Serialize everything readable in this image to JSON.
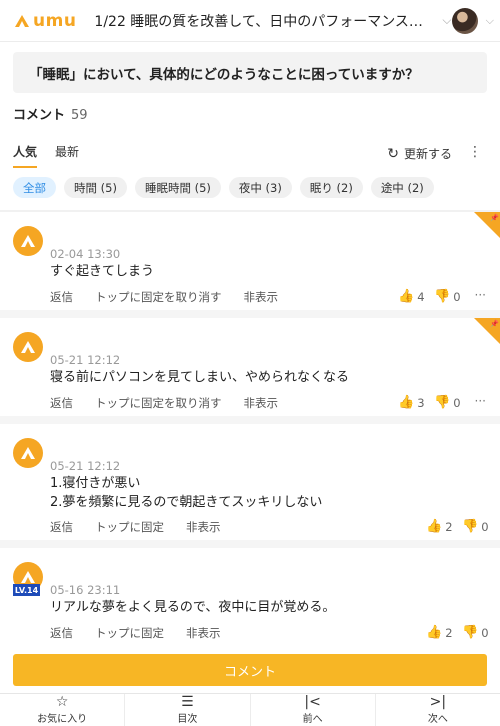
{
  "header": {
    "logo_text": "umu",
    "title": "1/22 睡眠の質を改善して、日中のパフォーマンスをあげよ…",
    "chevron_icon": "chevron-down-icon"
  },
  "question": "「睡眠」において、具体的にどのようなことに困っていますか？",
  "comments_header": {
    "label": "コメント",
    "count": "59"
  },
  "tabs": [
    {
      "label": "人気",
      "active": true
    },
    {
      "label": "最新",
      "active": false
    }
  ],
  "refresh_label": "更新する",
  "filters": [
    {
      "label": "全部",
      "active": true
    },
    {
      "label": "時間 (5)"
    },
    {
      "label": "睡眠時間 (5)"
    },
    {
      "label": "夜中 (3)"
    },
    {
      "label": "眠り (2)"
    },
    {
      "label": "途中 (2)"
    }
  ],
  "comments": [
    {
      "date": "02-04 13:30",
      "lines": [
        "すぐ起きてしまう"
      ],
      "actions": [
        "返信",
        "トップに固定を取り消す",
        "非表示"
      ],
      "likes": "4",
      "dislikes": "0",
      "pinned": true,
      "more": "···"
    },
    {
      "date": "05-21 12:12",
      "lines": [
        "寝る前にパソコンを見てしまい、やめられなくなる"
      ],
      "actions": [
        "返信",
        "トップに固定を取り消す",
        "非表示"
      ],
      "likes": "3",
      "dislikes": "0",
      "pinned": true,
      "more": "···"
    },
    {
      "date": "05-21 12:12",
      "lines": [
        "1.寝付きが悪い",
        "2.夢を頻繁に見るので朝起きてスッキリしない"
      ],
      "actions": [
        "返信",
        "トップに固定",
        "非表示"
      ],
      "likes": "2",
      "dislikes": "0",
      "pinned": false,
      "more": "···"
    },
    {
      "date": "05-16 23:11",
      "level": "LV.14",
      "lines": [
        "リアルな夢をよく見るので、夜中に目が覚める。"
      ],
      "actions": [
        "返信",
        "トップに固定",
        "非表示"
      ],
      "likes": "2",
      "dislikes": "0",
      "pinned": false,
      "more": "···"
    }
  ],
  "comment_button": "コメント",
  "footer": [
    {
      "icon": "star-icon",
      "glyph": "☆",
      "label": "お気に入り"
    },
    {
      "icon": "menu-icon",
      "glyph": "☰",
      "label": "目次"
    },
    {
      "icon": "prev-icon",
      "glyph": "|<",
      "label": "前へ"
    },
    {
      "icon": "next-icon",
      "glyph": ">|",
      "label": "次へ"
    }
  ],
  "colors": {
    "accent": "#f5a623",
    "button": "#f7b625",
    "chip_active_bg": "#e1f1ff",
    "chip_active_text": "#2f8de4",
    "level_badge": "#1e4bb8"
  }
}
